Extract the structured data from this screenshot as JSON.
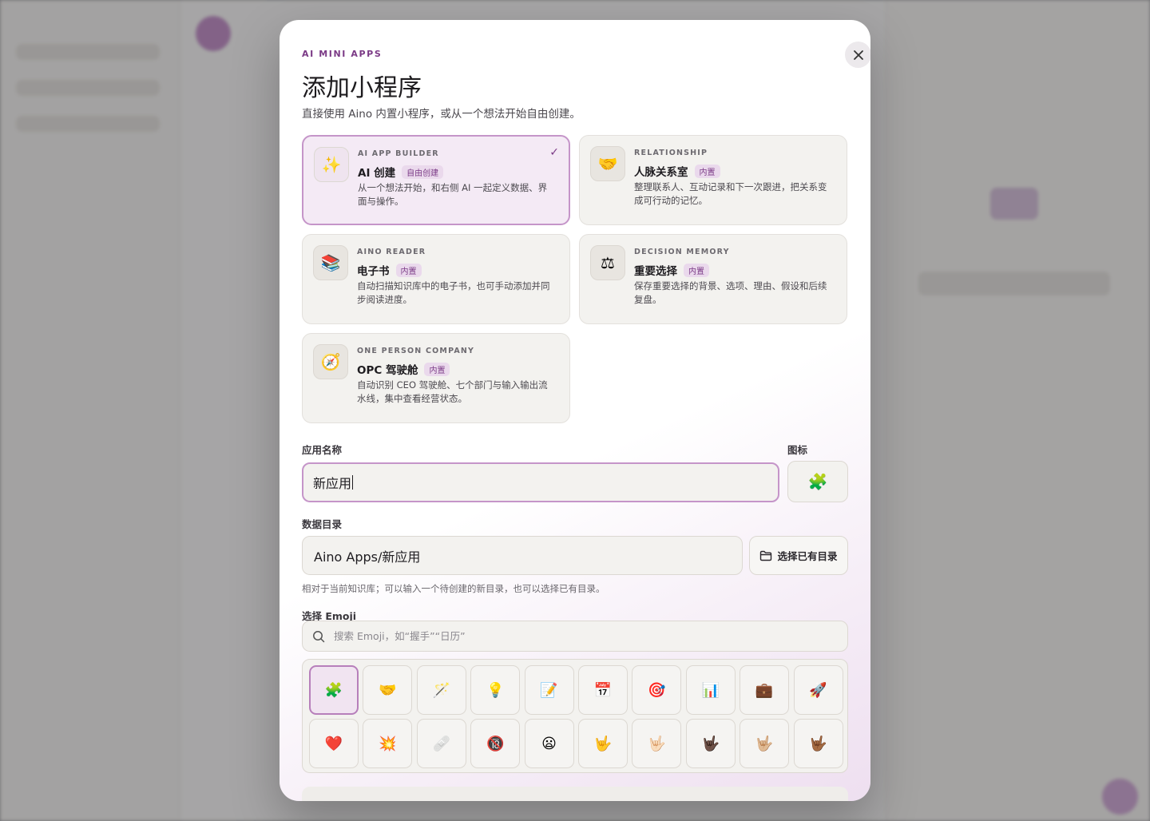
{
  "modal": {
    "eyebrow": "AI MINI APPS",
    "title": "添加小程序",
    "subtitle": "直接使用 Aino 内置小程序，或从一个想法开始自由创建。",
    "close_icon": "close-icon"
  },
  "cards": [
    {
      "kicker": "AI APP BUILDER",
      "name": "AI 创建",
      "badge": "自由创建",
      "desc": "从一个想法开始，和右侧 AI 一起定义数据、界面与操作。",
      "icon": "✨",
      "selected": true
    },
    {
      "kicker": "RELATIONSHIP",
      "name": "人脉关系室",
      "badge": "内置",
      "desc": "整理联系人、互动记录和下一次跟进，把关系变成可行动的记忆。",
      "icon": "🤝"
    },
    {
      "kicker": "AINO READER",
      "name": "电子书",
      "badge": "内置",
      "desc": "自动扫描知识库中的电子书，也可手动添加并同步阅读进度。",
      "icon": "📚"
    },
    {
      "kicker": "DECISION MEMORY",
      "name": "重要选择",
      "badge": "内置",
      "desc": "保存重要选择的背景、选项、理由、假设和后续复盘。",
      "icon": "⚖"
    },
    {
      "kicker": "ONE PERSON COMPANY",
      "name": "OPC 驾驶舱",
      "badge": "内置",
      "desc": "自动识别 CEO 驾驶舱、七个部门与输入输出流水线，集中查看经营状态。",
      "icon": "🧭"
    }
  ],
  "form": {
    "name_label": "应用名称",
    "name_value": "新应用",
    "icon_label": "图标",
    "icon_value": "🧩",
    "dir_label": "数据目录",
    "dir_value": "Aino Apps/新应用",
    "dir_button": "选择已有目录",
    "dir_hint": "相对于当前知识库；可以输入一个待创建的新目录，也可以选择已有目录。",
    "emoji_label": "选择 Emoji",
    "search_placeholder": "搜索 Emoji，如“握手”“日历”"
  },
  "emojis": [
    "🧩",
    "🤝",
    "🪄",
    "💡",
    "📝",
    "📅",
    "🎯",
    "📊",
    "💼",
    "🚀",
    "❤️",
    "💥",
    "🩹",
    "🔞",
    "😦",
    "🤟",
    "🤟🏻",
    "🤟🏿",
    "🤟🏼",
    "🤟🏾"
  ]
}
